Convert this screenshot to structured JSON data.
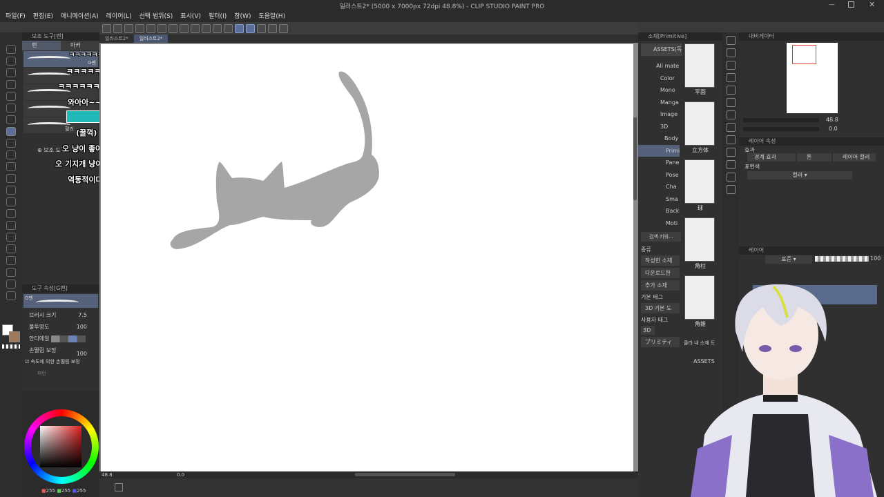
{
  "window": {
    "title": "일러스트2* (5000 x 7000px 72dpi 48.8%)  - CLIP STUDIO PAINT PRO"
  },
  "menu": [
    "파일(F)",
    "편집(E)",
    "애니메이션(A)",
    "레이어(L)",
    "선택 범위(S)",
    "표시(V)",
    "필터(I)",
    "창(W)",
    "도움말(H)"
  ],
  "subtool": {
    "panel_title": "보조 도구[펜]",
    "tabs": [
      "펜",
      "마커"
    ],
    "brush_labels": [
      "G펜",
      "혈러",
      "보조 도구"
    ]
  },
  "chat": [
    "ㅋㅋㅋㅋㅋㅋ",
    "ㅋㅋㅋㅋㅋㅋ",
    "ㅋㅋㅋㅋㅋㅋㅋ",
    "와아아~~",
    "(꿀꺽)",
    "오 냥이 좋아요",
    "오 기지개 냥이네요",
    "역동적이다"
  ],
  "tool_property": {
    "title": "도구 속성[G펜]",
    "brush_name": "G펜",
    "brush_size_label": "브러시 크기",
    "brush_size": "7.5",
    "opacity_label": "불투명도",
    "opacity": "100",
    "antialias_label": "안티에일",
    "stabilize_label": "손떨림 보정",
    "stabilize": "100",
    "speed_label": "속도에 의한 손떨림 보정",
    "more": "패턴"
  },
  "color": {
    "r": "255",
    "g": "255",
    "b": "255",
    "foreground": "#ffffff",
    "background": "#a0785a"
  },
  "doc_tabs": [
    "일러스트2*",
    "일러스트2*"
  ],
  "status": {
    "zoom": "48.8",
    "angle": "0.0"
  },
  "materials": {
    "panel_title": "소재[Primitive]",
    "root": "ASSETS(독",
    "tree": [
      "All mate",
      "Color",
      "Mono",
      "Manga",
      "Image",
      "3D",
      "Body",
      "Primi",
      "Panel",
      "Pose",
      "Cha",
      "Sma",
      "Backg",
      "Moti"
    ],
    "search": "검색 키워...",
    "category_label": "종류",
    "category_buttons": [
      "작성한 소재",
      "다운로드한",
      "추가 소재"
    ],
    "basic_tag_label": "기본 태그",
    "basic_tag": "3D 기본 도",
    "user_tag_label": "사용자 태그",
    "user_tag": "3D",
    "user_tag2": "プリミティ",
    "thumbs": [
      "平面",
      "立方体",
      "球",
      "角柱",
      "角錐"
    ],
    "footer": "ASSETS",
    "footer2": "클라 내 소재 도"
  },
  "navigator": {
    "title": "내비게이터",
    "zoom": "48.8",
    "angle": "0.0"
  },
  "layer_property": {
    "title": "레이어 속성",
    "effect_label": "효과",
    "border": "경계 효과",
    "tone": "톤",
    "layer_color": "레이어 컬러",
    "expression_label": "표현색",
    "expression": "컬러"
  },
  "layers": {
    "title": "레이어",
    "blend": "표준",
    "opacity": "100"
  }
}
